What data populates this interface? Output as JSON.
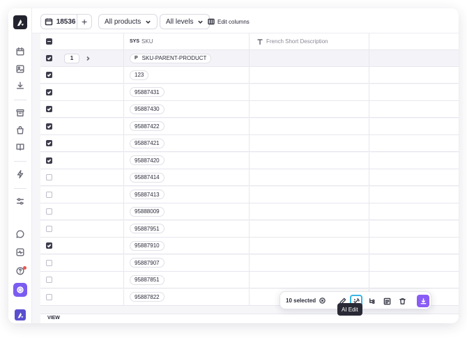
{
  "toolbar": {
    "product_count": "18536",
    "plus_label": "+",
    "products_filter": "All products",
    "levels_filter": "All levels",
    "edit_columns": "Edit columns"
  },
  "columns": {
    "sku_prefix": "SYS",
    "sku_label": "SKU",
    "french_desc": "French Short Description"
  },
  "parent_row": {
    "level": "1",
    "badge": "P",
    "sku": "SKU-PARENT-PRODUCT",
    "checked": true
  },
  "rows": [
    {
      "sku": "123",
      "checked": true
    },
    {
      "sku": "95887431",
      "checked": true
    },
    {
      "sku": "95887430",
      "checked": true
    },
    {
      "sku": "95887422",
      "checked": true
    },
    {
      "sku": "95887421",
      "checked": true
    },
    {
      "sku": "95887420",
      "checked": true
    },
    {
      "sku": "95887414",
      "checked": false
    },
    {
      "sku": "95887413",
      "checked": false
    },
    {
      "sku": "95888009",
      "checked": false
    },
    {
      "sku": "95887951",
      "checked": false
    },
    {
      "sku": "95887910",
      "checked": true
    },
    {
      "sku": "95887907",
      "checked": false
    },
    {
      "sku": "95887851",
      "checked": false
    },
    {
      "sku": "95887822",
      "checked": false
    }
  ],
  "bottom": {
    "view_label": "VIEW"
  },
  "action_bar": {
    "selected_text": "10 selected",
    "tooltip": "AI Edit"
  },
  "icons": {
    "sidebar": [
      "calendar-icon",
      "image-icon",
      "download-icon",
      "archive-icon",
      "bag-icon",
      "book-icon",
      "bolt-icon",
      "sliders-icon",
      "chat-icon",
      "activity-icon",
      "help-icon",
      "settings-icon"
    ],
    "actions": [
      "pencil-icon",
      "ai-edit-icon",
      "hierarchy-icon",
      "list-icon",
      "trash-icon",
      "download-icon"
    ]
  },
  "colors": {
    "accent": "#7b5cf0",
    "focus_ring": "#3ab4e6",
    "checkbox_on": "#3c3c4c"
  }
}
